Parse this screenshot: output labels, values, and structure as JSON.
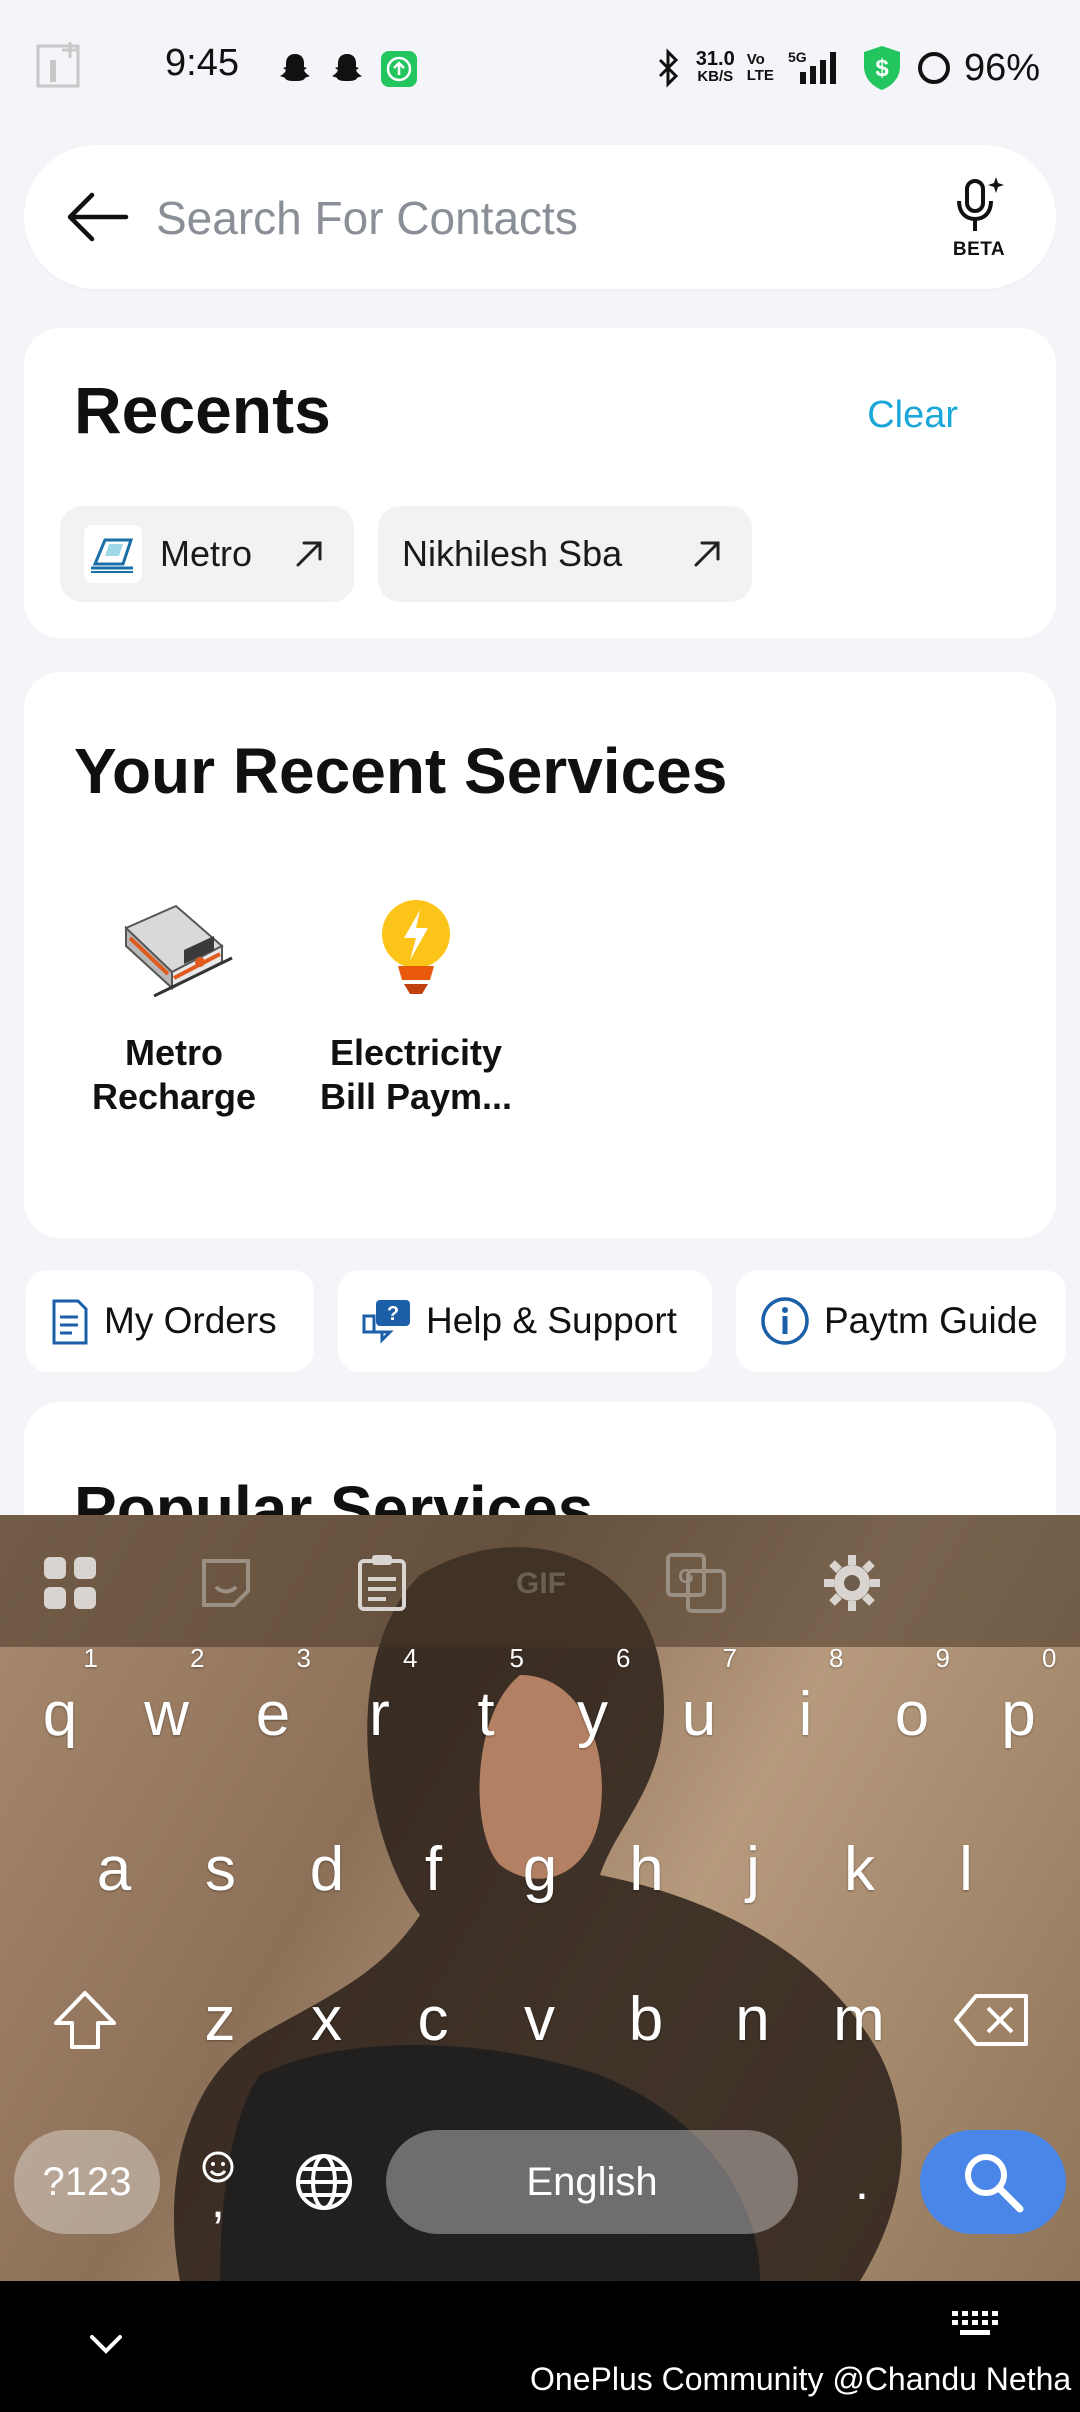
{
  "status": {
    "time": "9:45",
    "net_speed_value": "31.0",
    "net_speed_unit": "KB/S",
    "volte_top": "Vo",
    "volte_bottom": "LTE",
    "network": "5G",
    "battery": "96%"
  },
  "search": {
    "placeholder": "Search For Contacts",
    "voice_badge": "BETA"
  },
  "recents": {
    "title": "Recents",
    "clear_label": "Clear",
    "chips": [
      {
        "label": "Metro"
      },
      {
        "label": "Nikhilesh Sba"
      }
    ]
  },
  "recent_services": {
    "title": "Your Recent Services",
    "items": [
      {
        "line1": "Metro",
        "line2": "Recharge"
      },
      {
        "line1": "Electricity",
        "line2": "Bill Paym..."
      }
    ]
  },
  "quick_links": [
    {
      "label": "My Orders"
    },
    {
      "label": "Help & Support"
    },
    {
      "label": "Paytm Guide"
    }
  ],
  "popular": {
    "title": "Popular Services"
  },
  "keyboard": {
    "toolbar": [
      "apps-icon",
      "sticker-icon",
      "clipboard-icon",
      "gif-icon",
      "translate-icon",
      "settings-icon"
    ],
    "gif_label": "GIF",
    "row1": [
      {
        "k": "q",
        "n": "1"
      },
      {
        "k": "w",
        "n": "2"
      },
      {
        "k": "e",
        "n": "3"
      },
      {
        "k": "r",
        "n": "4"
      },
      {
        "k": "t",
        "n": "5"
      },
      {
        "k": "y",
        "n": "6"
      },
      {
        "k": "u",
        "n": "7"
      },
      {
        "k": "i",
        "n": "8"
      },
      {
        "k": "o",
        "n": "9"
      },
      {
        "k": "p",
        "n": "0"
      }
    ],
    "row2": [
      "a",
      "s",
      "d",
      "f",
      "g",
      "h",
      "j",
      "k",
      "l"
    ],
    "row3": [
      "z",
      "x",
      "c",
      "v",
      "b",
      "n",
      "m"
    ],
    "symbols_label": "?123",
    "space_label": "English",
    "period": ".",
    "comma": ","
  },
  "navbar": {
    "watermark": "OnePlus Community @Chandu Netha"
  },
  "colors": {
    "accent": "#1ba7d8",
    "search_key": "#4a86e8",
    "background": "#f3f5f9"
  }
}
